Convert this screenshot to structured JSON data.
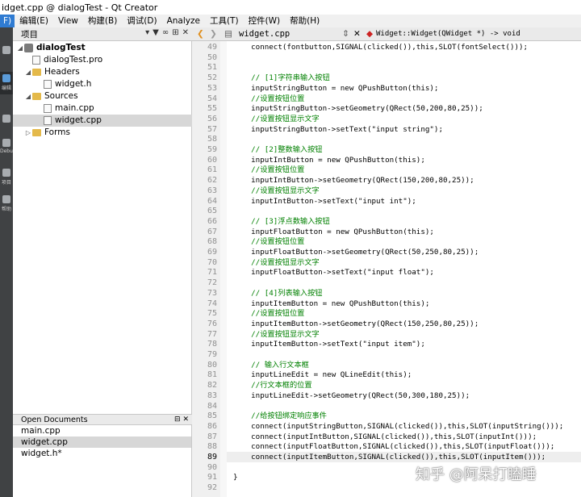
{
  "window": {
    "title": "idget.cpp @ dialogTest - Qt Creator"
  },
  "menu": [
    "F)",
    "编辑(E)",
    "View",
    "构建(B)",
    "调试(D)",
    "Analyze",
    "工具(T)",
    "控件(W)",
    "帮助(H)"
  ],
  "modebar": {
    "labels": [
      "",
      "编辑",
      "",
      "Debug",
      "项目",
      "帮助"
    ]
  },
  "project_pane": {
    "title": "项目",
    "tree": [
      {
        "label": "dialogTest",
        "kind": "project",
        "expanded": true
      },
      {
        "label": "dialogTest.pro",
        "kind": "file"
      },
      {
        "label": "Headers",
        "kind": "folder",
        "expanded": true
      },
      {
        "label": "widget.h",
        "kind": "file"
      },
      {
        "label": "Sources",
        "kind": "folder",
        "expanded": true
      },
      {
        "label": "main.cpp",
        "kind": "file"
      },
      {
        "label": "widget.cpp",
        "kind": "file",
        "selected": true
      },
      {
        "label": "Forms",
        "kind": "folder",
        "expanded": false
      }
    ]
  },
  "open_documents": {
    "title": "Open Documents",
    "items": [
      "main.cpp",
      "widget.cpp",
      "widget.h*"
    ],
    "selected_index": 1
  },
  "editor": {
    "file_tab": "widget.cpp",
    "function_scope": "Widget::Widget(QWidget *) -> void",
    "current_line": 89,
    "first_line": 49,
    "lines": [
      "        connect(fontbutton,SIGNAL(clicked()),this,SLOT(fontSelect()));",
      "",
      "",
      "        // [1]字符串输入按钮",
      "        inputStringButton = new QPushButton(this);",
      "        //设置按钮位置",
      "        inputStringButton->setGeometry(QRect(50,200,80,25));",
      "        //设置按钮显示文字",
      "        inputStringButton->setText(\"input string\");",
      "",
      "        // [2]整数输入按钮",
      "        inputIntButton = new QPushButton(this);",
      "        //设置按钮位置",
      "        inputIntButton->setGeometry(QRect(150,200,80,25));",
      "        //设置按钮显示文字",
      "        inputIntButton->setText(\"input int\");",
      "",
      "        // [3]浮点数输入按钮",
      "        inputFloatButton = new QPushButton(this);",
      "        //设置按钮位置",
      "        inputFloatButton->setGeometry(QRect(50,250,80,25));",
      "        //设置按钮显示文字",
      "        inputFloatButton->setText(\"input float\");",
      "",
      "        // [4]列表输入按钮",
      "        inputItemButton = new QPushButton(this);",
      "        //设置按钮位置",
      "        inputItemButton->setGeometry(QRect(150,250,80,25));",
      "        //设置按钮显示文字",
      "        inputItemButton->setText(\"input item\");",
      "",
      "        // 输入行文本框",
      "        inputLineEdit = new QLineEdit(this);",
      "        //行文本框的位置",
      "        inputLineEdit->setGeometry(QRect(50,300,180,25));",
      "",
      "        //给按钮绑定响应事件",
      "        connect(inputStringButton,SIGNAL(clicked()),this,SLOT(inputString()));",
      "        connect(inputIntButton,SIGNAL(clicked()),this,SLOT(inputInt()));",
      "        connect(inputFloatButton,SIGNAL(clicked()),this,SLOT(inputFloat()));",
      "        connect(inputItemButton,SIGNAL(clicked()),this,SLOT(inputItem()));",
      "",
      "}",
      ""
    ]
  },
  "watermark": "知乎 @阿呆打瞌睡"
}
